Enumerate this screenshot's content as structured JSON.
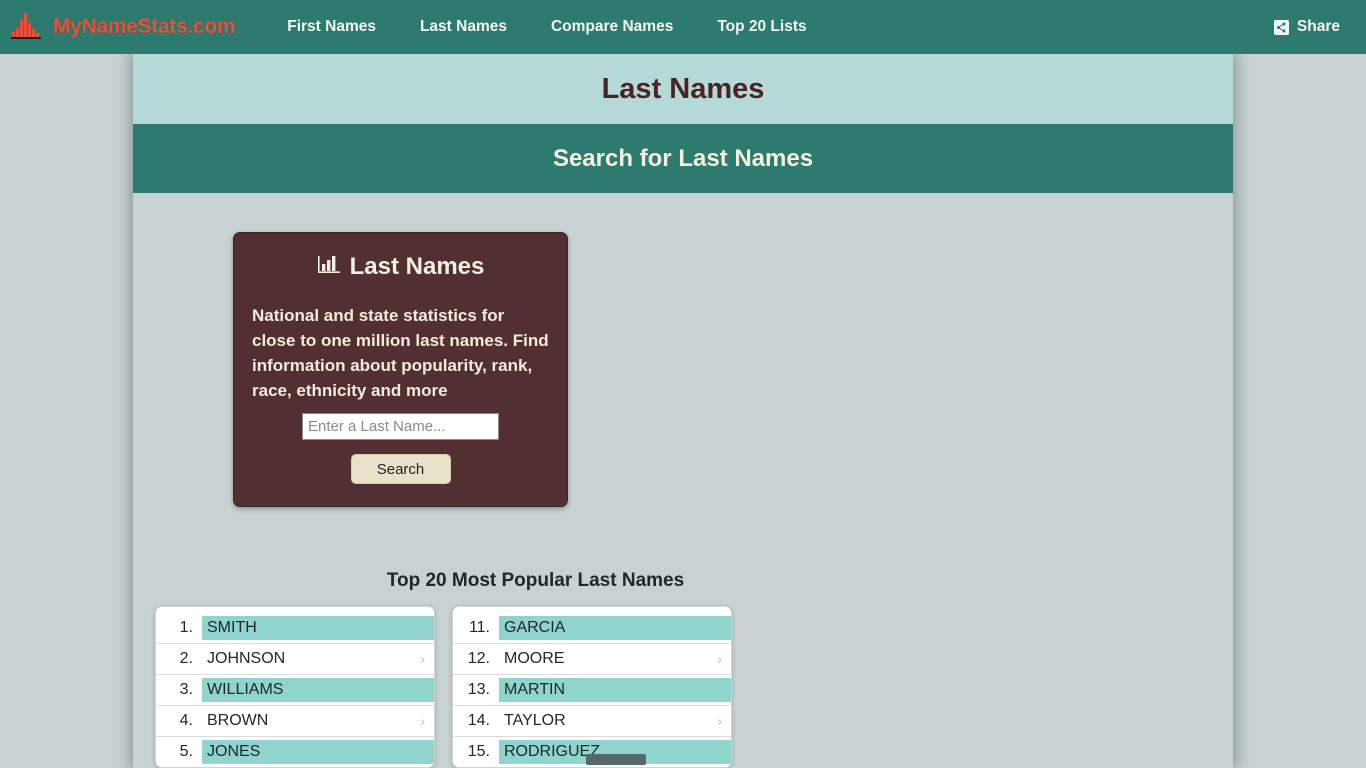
{
  "navbar": {
    "brand": {
      "text": "MyNameStats.com",
      "icon": "bar-chart-icon"
    },
    "links": [
      {
        "label": "First Names"
      },
      {
        "label": "Last Names"
      },
      {
        "label": "Compare Names"
      },
      {
        "label": "Top 20 Lists"
      }
    ],
    "share": {
      "label": "Share",
      "icon": "share-icon"
    },
    "background": "#2d7a6f",
    "brand_color": "#e8503a"
  },
  "page": {
    "title": "Last Names",
    "title_bar_background": "#b5d9d6",
    "section_title": "Search for Last Names",
    "section_bar_background": "#2d7a6f",
    "background": "#c8d2d2"
  },
  "search_card": {
    "icon": "bar-chart-icon",
    "title": "Last Names",
    "description": "National and state statistics for close to one million last names. Find information about popularity, rank, race, ethnicity and more",
    "input_value": "",
    "input_placeholder": "Enter a Last Name...",
    "button_label": "Search",
    "background": "#522f33",
    "text_color": "#f4f0e0"
  },
  "top_list": {
    "heading": "Top 20 Most Popular Last Names",
    "highlight_color": "#8fd4cd",
    "column_1": [
      {
        "rank": "1.",
        "name": "SMITH"
      },
      {
        "rank": "2.",
        "name": "JOHNSON"
      },
      {
        "rank": "3.",
        "name": "WILLIAMS"
      },
      {
        "rank": "4.",
        "name": "BROWN"
      },
      {
        "rank": "5.",
        "name": "JONES"
      }
    ],
    "column_2": [
      {
        "rank": "11.",
        "name": "GARCIA"
      },
      {
        "rank": "12.",
        "name": "MOORE"
      },
      {
        "rank": "13.",
        "name": "MARTIN"
      },
      {
        "rank": "14.",
        "name": "TAYLOR"
      },
      {
        "rank": "15.",
        "name": "RODRIGUEZ"
      }
    ],
    "chevron": "›"
  }
}
